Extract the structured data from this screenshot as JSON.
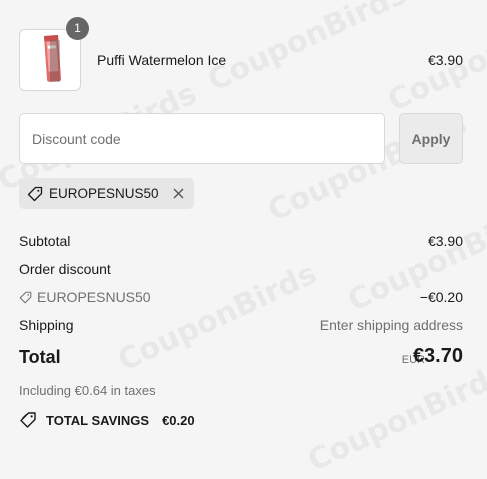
{
  "product": {
    "quantity": "1",
    "name": "Puffi Watermelon Ice",
    "price": "€3.90"
  },
  "discount": {
    "placeholder": "Discount code",
    "apply_label": "Apply",
    "applied_code": "EUROPESNUS50"
  },
  "summary": {
    "subtotal_label": "Subtotal",
    "subtotal_value": "€3.90",
    "order_discount_label": "Order discount",
    "discount_code": "EUROPESNUS50",
    "discount_value": "−€0.20",
    "shipping_label": "Shipping",
    "shipping_value": "Enter shipping address",
    "total_label": "Total",
    "total_currency": "EUR",
    "total_value": "€3.70",
    "taxes_note": "Including €0.64 in taxes",
    "savings_label": "TOTAL SAVINGS",
    "savings_value": "€0.20"
  },
  "watermark": "CouponBirds",
  "icons": {
    "tag": "tag-icon",
    "close": "close-icon",
    "savings": "savings-tag-icon"
  }
}
